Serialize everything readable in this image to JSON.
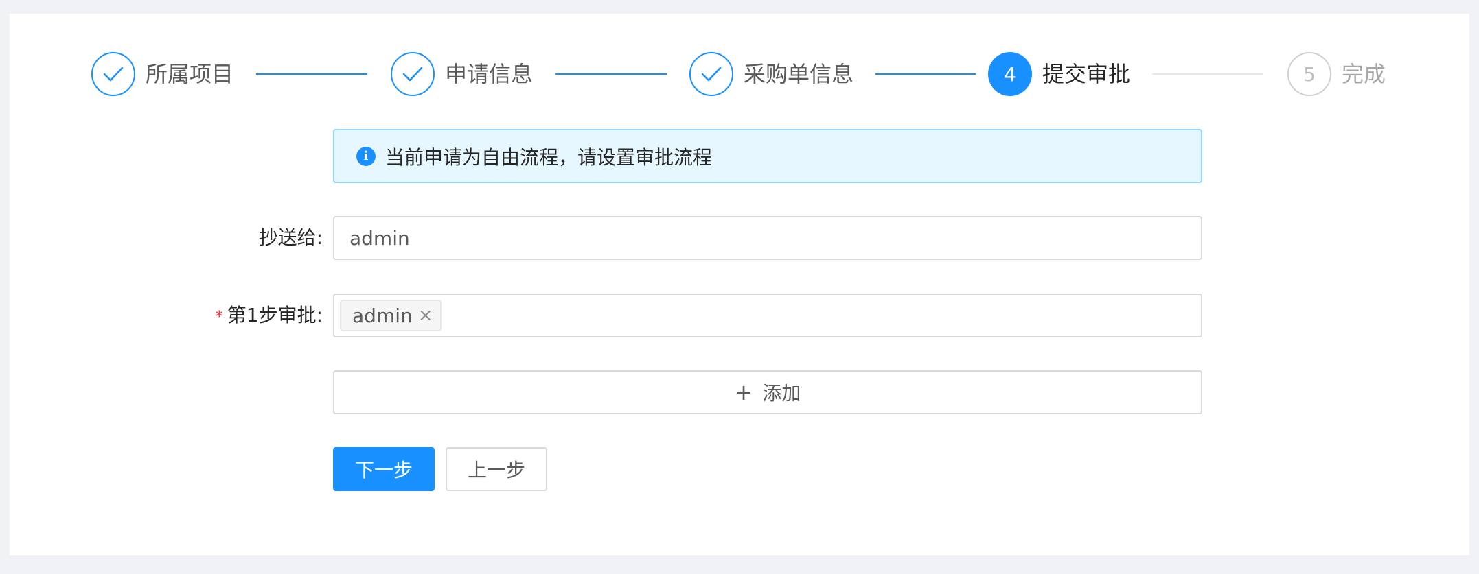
{
  "steps": [
    {
      "title": "所属项目",
      "status": "finished"
    },
    {
      "title": "申请信息",
      "status": "finished"
    },
    {
      "title": "采购单信息",
      "status": "finished"
    },
    {
      "title": "提交审批",
      "status": "process",
      "number": "4"
    },
    {
      "title": "完成",
      "status": "wait",
      "number": "5"
    }
  ],
  "alert": {
    "icon": "info-icon",
    "message": "当前申请为自由流程，请设置审批流程"
  },
  "form": {
    "cc": {
      "label": "抄送给:",
      "value": "admin"
    },
    "step1": {
      "required_mark": "*",
      "label": "第1步审批:",
      "tags": [
        {
          "text": "admin",
          "close": "×"
        }
      ]
    },
    "add_button": {
      "icon": "plus-icon",
      "plus": "+",
      "label": "添加"
    }
  },
  "actions": {
    "next_label": "下一步",
    "prev_label": "上一步"
  },
  "colors": {
    "primary": "#1890ff",
    "alert_bg": "#e6f7ff",
    "alert_border": "#91d5ff",
    "required": "#f5222d"
  }
}
